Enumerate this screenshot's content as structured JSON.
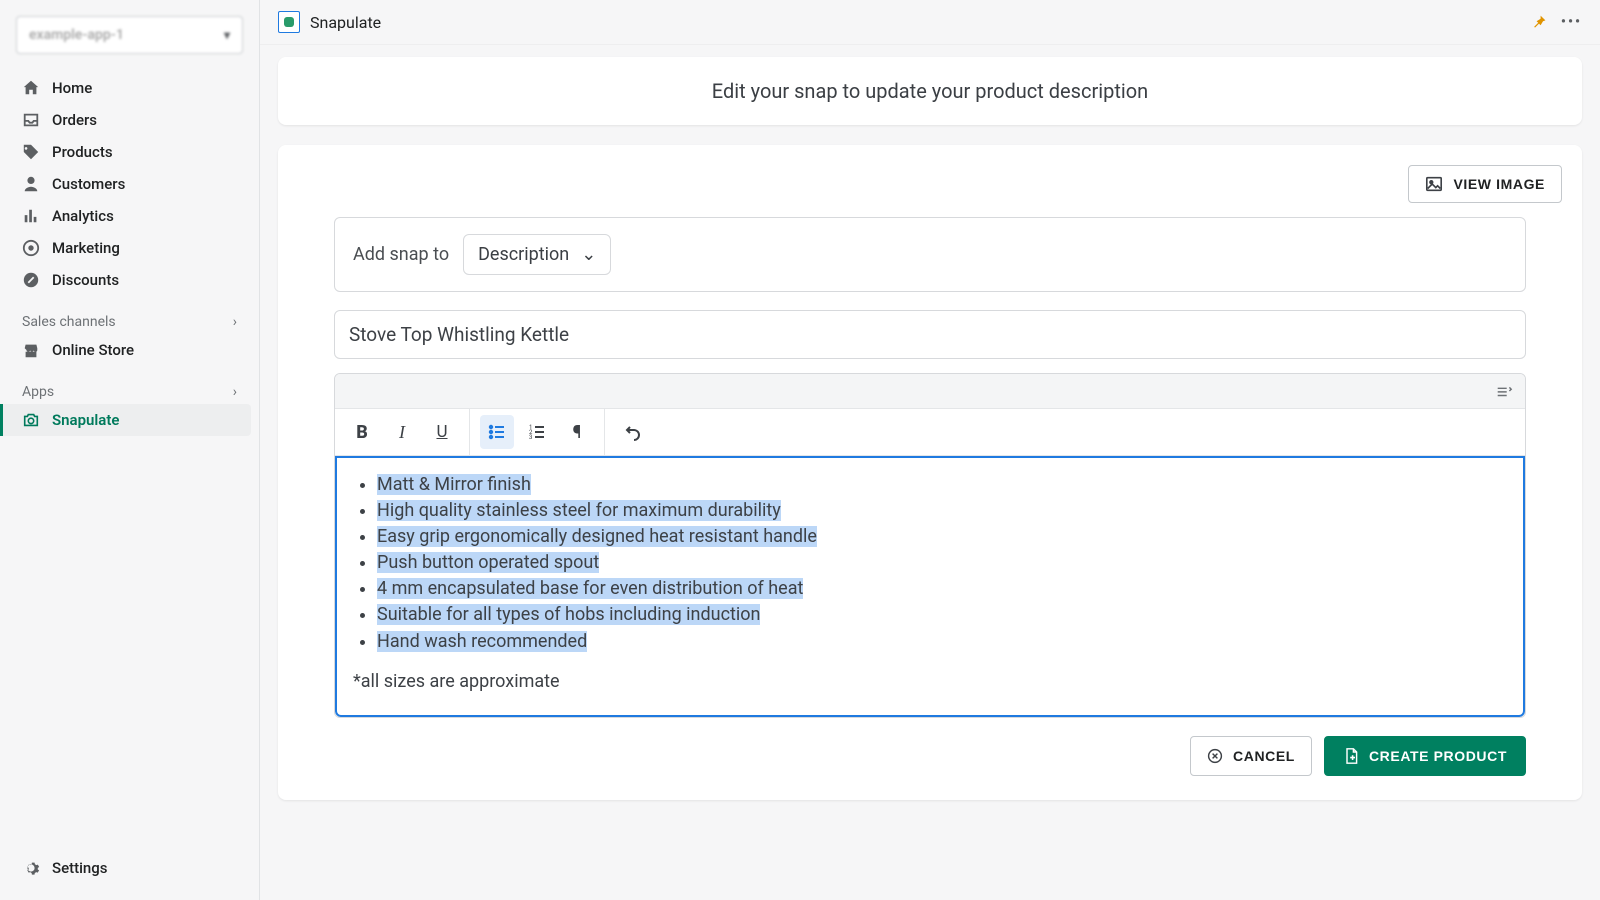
{
  "store_name": "example-app-1",
  "nav": {
    "home": "Home",
    "orders": "Orders",
    "products": "Products",
    "customers": "Customers",
    "analytics": "Analytics",
    "marketing": "Marketing",
    "discounts": "Discounts",
    "sales_channels_header": "Sales channels",
    "online_store": "Online Store",
    "apps_header": "Apps",
    "snapulate": "Snapulate",
    "settings": "Settings"
  },
  "topbar": {
    "app_name": "Snapulate"
  },
  "banner": {
    "text": "Edit your snap to update your product description"
  },
  "buttons": {
    "view_image": "VIEW IMAGE",
    "cancel": "CANCEL",
    "create_product": "CREATE PRODUCT"
  },
  "form": {
    "add_snap_label": "Add snap to",
    "add_snap_selected": "Description",
    "title_value": "Stove Top Whistling Kettle",
    "bullets": [
      "Matt & Mirror finish",
      "High quality stainless steel for maximum durability",
      "Easy grip ergonomically designed heat resistant handle",
      "Push button operated spout",
      "4 mm encapsulated base for even distribution of heat",
      "Suitable for all types of hobs including induction",
      "Hand wash recommended"
    ],
    "footnote": "*all sizes are approximate"
  }
}
